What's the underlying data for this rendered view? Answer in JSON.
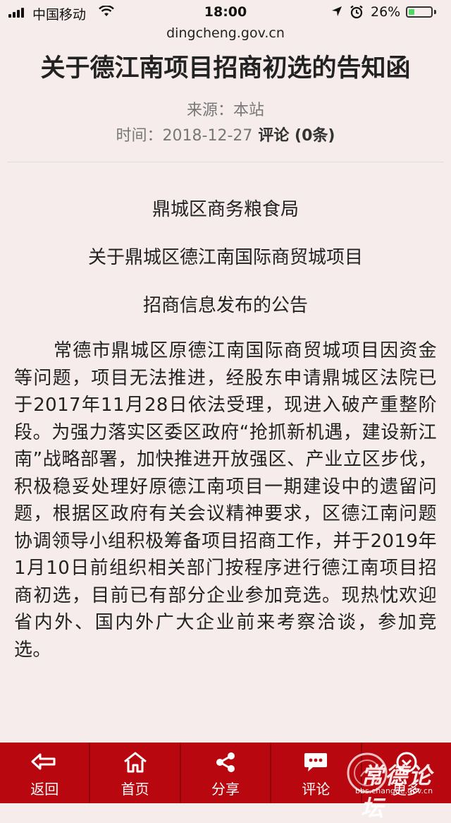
{
  "status": {
    "carrier": "中国移动",
    "time": "18:00",
    "battery": "26%",
    "battery_level": 0.26
  },
  "browser": {
    "url": "dingcheng.gov.cn"
  },
  "article": {
    "title": "关于德江南项目招商初选的告知函",
    "source": "来源：本站",
    "date": "时间：2018-12-27",
    "comments": "评论 (0条)",
    "heading_lines": [
      "鼎城区商务粮食局",
      "关于鼎城区德江南国际商贸城项目",
      "招商信息发布的公告"
    ],
    "body": "常德市鼎城区原德江南国际商贸城项目因资金等问题，项目无法推进，经股东申请鼎城区法院已于2017年11月28日依法受理，现进入破产重整阶段。为强力落实区委区政府“抢抓新机遇，建设新江南”战略部署，加快推进开放强区、产业立区步伐，积极稳妥处理好原德江南项目一期建设中的遗留问题，根据区政府有关会议精神要求，区德江南问题协调领导小组积极筹备项目招商工作，并于2019年1月10日前组织相关部门按程序进行德江南项目招商初选，目前已有部分企业参加竞选。现热忱欢迎省内外、国内外广大企业前来考察洽谈，参加竞选。"
  },
  "bottom_nav": [
    {
      "label": "返回",
      "icon": "back-arrow-icon"
    },
    {
      "label": "首页",
      "icon": "home-icon"
    },
    {
      "label": "分享",
      "icon": "share-icon"
    },
    {
      "label": "评论",
      "icon": "comment-icon"
    },
    {
      "label": "更多",
      "icon": "more-icon"
    }
  ],
  "watermark": {
    "text": "常德论坛",
    "url": "bbs.changde.gov.cn"
  },
  "colors": {
    "nav_bg": "#b8070e",
    "page_bg": "#f6ecec",
    "battery": "#4cd964"
  }
}
